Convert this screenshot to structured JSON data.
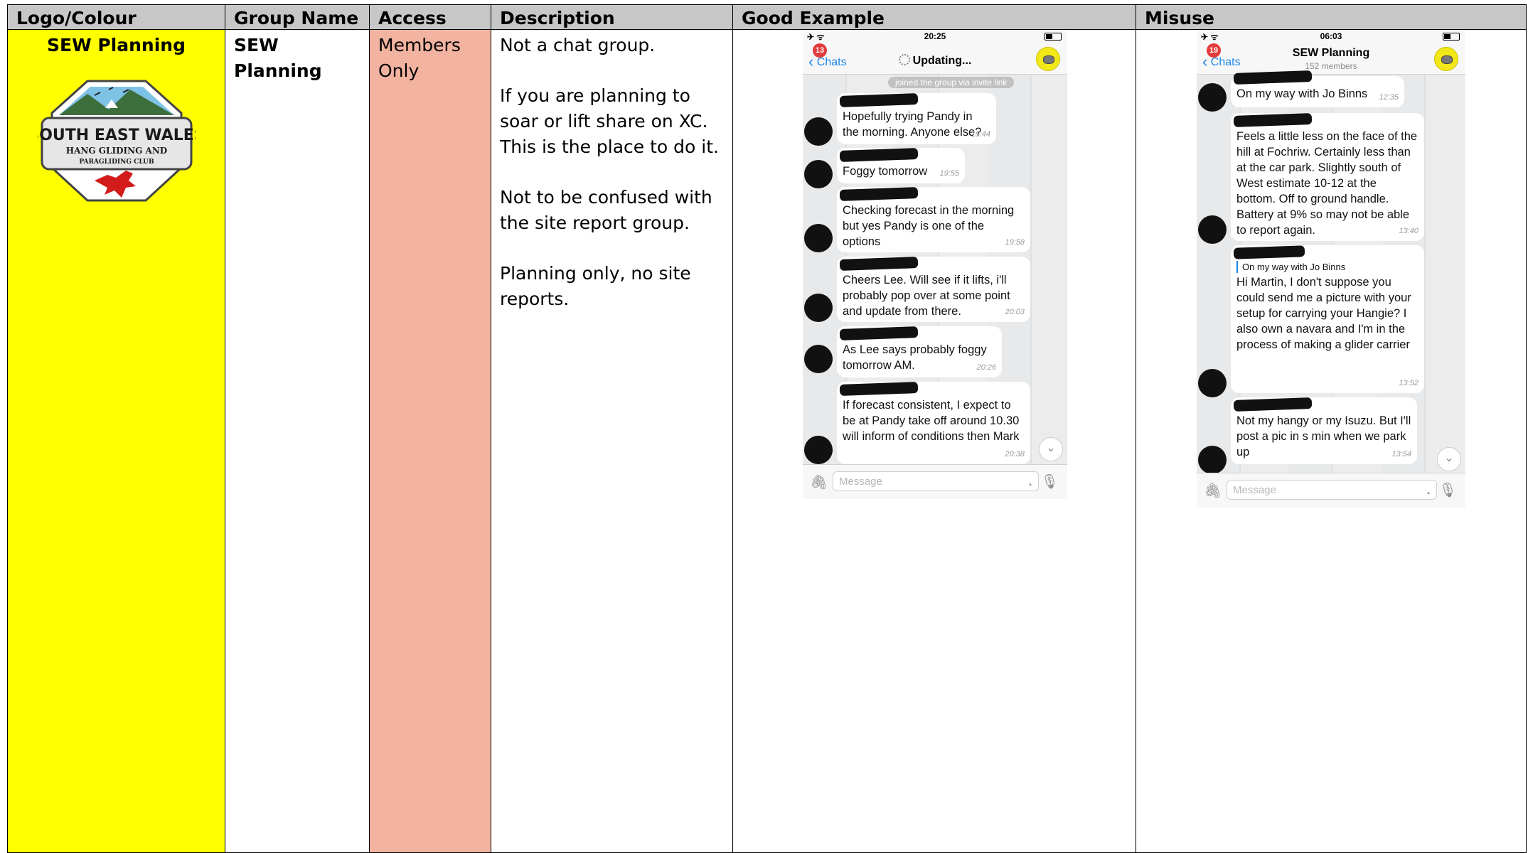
{
  "table": {
    "headers": [
      "Logo/Colour",
      "Group Name",
      "Access",
      "Description",
      "Good Example",
      "Misuse"
    ],
    "row": {
      "logo_title": "SEW Planning",
      "group_name": "SEW Planning",
      "access": "Members Only",
      "description": [
        "Not a chat group.",
        "If you are planning to soar or lift share on XC. This is the place to do it.",
        "Not to be confused with the site report group.",
        "Planning only, no site reports."
      ]
    },
    "colors": {
      "header_bg": "#c7c7c7",
      "logo_bg": "#ffff00",
      "access_bg": "#f2b3a0"
    }
  },
  "logo": {
    "line1": "SOUTH EAST WALES",
    "line2": "HANG GLIDING AND",
    "line3": "PARAGLIDING CLUB"
  },
  "good_example": {
    "time": "20:25",
    "back_label": "Chats",
    "badge": "13",
    "title": "Updating...",
    "system_message": "joined the group via invite link",
    "messages": [
      {
        "text": "Hopefully trying Pandy in the morning. Anyone else?",
        "time": "19:44"
      },
      {
        "text": "Foggy tomorrow",
        "time": "19:55"
      },
      {
        "text": "Checking forecast in the morning but yes Pandy is one of the options",
        "time": "19:58"
      },
      {
        "text": "Cheers Lee. Will see if it lifts, i'll probably pop over at some point and update from there.",
        "time": "20:03"
      },
      {
        "text": "As Lee says probably foggy tomorrow AM.",
        "time": "20:26"
      },
      {
        "text": "If forecast consistent, I  expect to be at Pandy take off around 10.30 will inform of conditions then Mark",
        "time": "20:38"
      }
    ],
    "input_placeholder": "Message"
  },
  "misuse": {
    "time": "06:03",
    "back_label": "Chats",
    "badge": "19",
    "title": "SEW Planning",
    "subtitle": "152 members",
    "messages": [
      {
        "text": "On my way with Jo Binns",
        "time": "12:35"
      },
      {
        "text": "Feels a little less on the face of the hill at Fochriw. Certainly less than at the car park. Slightly south of West estimate 10-12 at the bottom. Off to ground handle. Battery at 9% so may not be able to report again.",
        "time": "13:40"
      },
      {
        "quote": "On my way with Jo Binns",
        "text": "Hi Martin, I don't suppose you could send me a picture with your setup for carrying your Hangie? I also own a navara and I'm in the process of making a glider carrier",
        "time": "13:52"
      },
      {
        "text": "Not my hangy or my Isuzu. But I'll post a pic in s min when we park up",
        "time": "13:54"
      }
    ],
    "input_placeholder": "Message"
  }
}
